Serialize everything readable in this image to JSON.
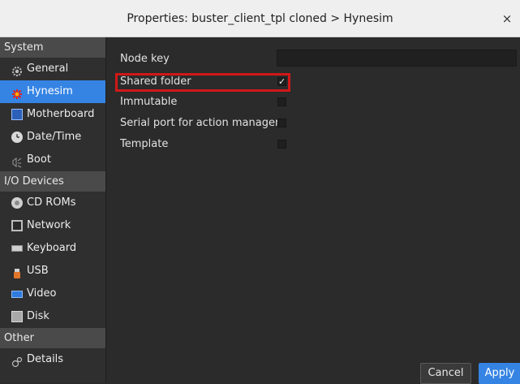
{
  "window": {
    "title": "Properties: buster_client_tpl cloned > Hynesim",
    "close_glyph": "×"
  },
  "sidebar": {
    "sections": [
      {
        "label": "System",
        "items": [
          {
            "label": "General",
            "icon": "gear-icon",
            "selected": false
          },
          {
            "label": "Hynesim",
            "icon": "hynesim-logo-icon",
            "selected": true
          },
          {
            "label": "Motherboard",
            "icon": "motherboard-icon",
            "selected": false
          },
          {
            "label": "Date/Time",
            "icon": "clock-icon",
            "selected": false
          },
          {
            "label": "Boot",
            "icon": "boot-icon",
            "selected": false
          }
        ]
      },
      {
        "label": "I/O Devices",
        "items": [
          {
            "label": "CD ROMs",
            "icon": "cd-icon",
            "selected": false
          },
          {
            "label": "Network",
            "icon": "network-icon",
            "selected": false
          },
          {
            "label": "Keyboard",
            "icon": "keyboard-icon",
            "selected": false
          },
          {
            "label": "USB",
            "icon": "usb-icon",
            "selected": false
          },
          {
            "label": "Video",
            "icon": "video-icon",
            "selected": false
          },
          {
            "label": "Disk",
            "icon": "disk-icon",
            "selected": false
          }
        ]
      },
      {
        "label": "Other",
        "items": [
          {
            "label": "Details",
            "icon": "details-icon",
            "selected": false
          }
        ]
      }
    ]
  },
  "form": {
    "node_key": {
      "label": "Node key",
      "value": ""
    },
    "shared_folder": {
      "label": "Shared folder",
      "checked": true
    },
    "immutable": {
      "label": "Immutable",
      "checked": false
    },
    "serial_port": {
      "label": "Serial port for action manager",
      "checked": false
    },
    "template": {
      "label": "Template",
      "checked": false
    }
  },
  "buttons": {
    "cancel": "Cancel",
    "apply": "Apply"
  },
  "colors": {
    "accent": "#3584e4",
    "highlight": "#d01818",
    "background": "#2b2b2b"
  }
}
